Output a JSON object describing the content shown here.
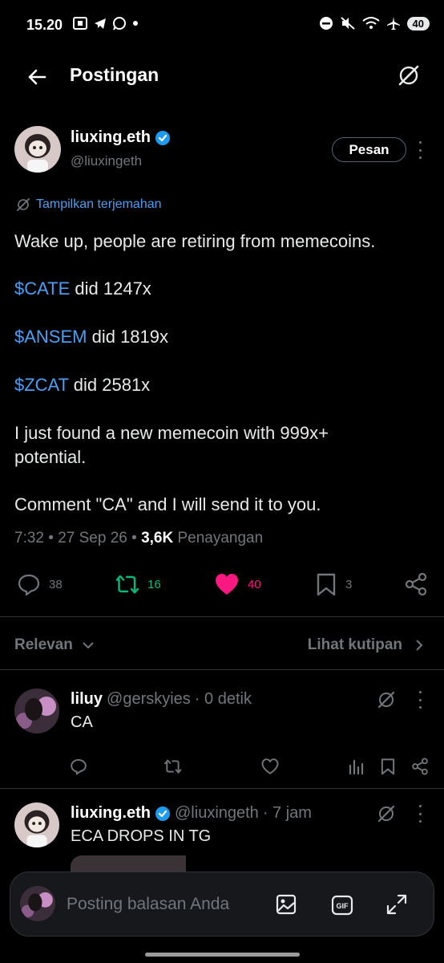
{
  "status_bar": {
    "time": "15.20",
    "battery": "40"
  },
  "header": {
    "title": "Postingan"
  },
  "author": {
    "name": "liuxing.eth",
    "handle": "@liuxingeth",
    "message_button": "Pesan"
  },
  "translate_label": "Tampilkan terjemahan",
  "post": {
    "line1": "Wake up, people are retiring from memecoins.",
    "cashtag1": "$CATE",
    "rest1": " did 1247x",
    "cashtag2": "$ANSEM",
    "rest2": " did 1819x",
    "cashtag3": "$ZCAT",
    "rest3": " did 2581x",
    "line5": "I just found a new memecoin with 999x+ potential.",
    "line6": "Comment \"CA\" and I will send it to you."
  },
  "meta": {
    "time": "7:32",
    "sep1": " • ",
    "date": "27 Sep 26",
    "sep2": " • ",
    "views_count": "3,6K",
    "views_label": " Penayangan"
  },
  "actions": {
    "replies": "38",
    "reposts": "16",
    "likes": "40",
    "bookmarks": "3"
  },
  "colors": {
    "like": "#f91880",
    "repost": "#00ba7c",
    "link": "#4a9ff5",
    "verified": "#1d9bf0"
  },
  "sort": {
    "label": "Relevan",
    "quotes_label": "Lihat kutipan"
  },
  "replies": [
    {
      "name": "liluy",
      "handle": "@gerskyies",
      "time": "· 0 detik",
      "text": "CA"
    },
    {
      "name": "liuxing.eth",
      "handle": "@liuxingeth",
      "time": "· 7 jam",
      "text": "ECA DROPS IN TG"
    }
  ],
  "composer": {
    "placeholder": "Posting balasan Anda"
  }
}
